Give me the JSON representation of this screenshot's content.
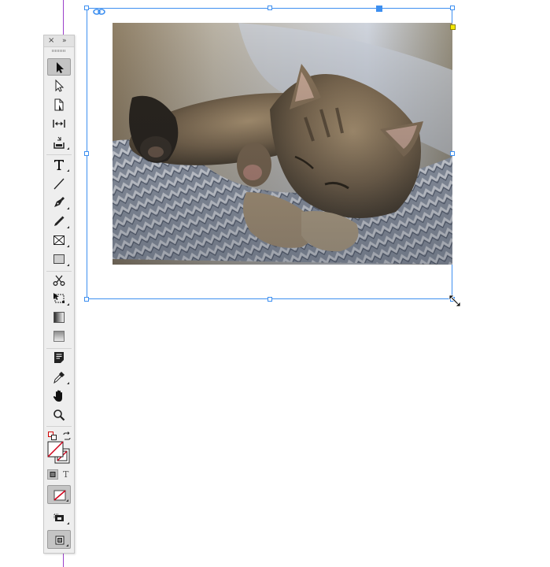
{
  "panel": {
    "close_glyph": "×",
    "collapse_glyph": "»",
    "tools": [
      {
        "name": "selection-tool",
        "icon": "black-arrow-icon",
        "selected": true
      },
      {
        "name": "direct-selection-tool",
        "icon": "white-arrow-icon"
      },
      {
        "name": "page-tool",
        "icon": "page-icon"
      },
      {
        "name": "gap-tool",
        "icon": "gap-arrows-icon"
      },
      {
        "name": "content-collector-tool",
        "icon": "content-collector-icon"
      },
      {
        "name": "type-tool",
        "icon": "type-T-icon"
      },
      {
        "name": "line-tool",
        "icon": "line-icon"
      },
      {
        "name": "pen-tool",
        "icon": "pen-icon"
      },
      {
        "name": "pencil-tool",
        "icon": "pencil-icon"
      },
      {
        "name": "rectangle-frame-tool",
        "icon": "rectangle-frame-icon"
      },
      {
        "name": "rectangle-tool",
        "icon": "rectangle-icon"
      },
      {
        "name": "scissors-tool",
        "icon": "scissors-icon"
      },
      {
        "name": "free-transform-tool",
        "icon": "free-transform-icon"
      },
      {
        "name": "gradient-swatch-tool",
        "icon": "gradient-swatch-icon"
      },
      {
        "name": "gradient-feather-tool",
        "icon": "gradient-feather-icon"
      },
      {
        "name": "note-tool",
        "icon": "note-icon"
      },
      {
        "name": "eyedropper-tool",
        "icon": "eyedropper-icon"
      },
      {
        "name": "hand-tool",
        "icon": "hand-icon"
      },
      {
        "name": "zoom-tool",
        "icon": "magnifier-icon"
      }
    ],
    "formatting_text_glyph": "T"
  },
  "colors": {
    "selection": "#3d8ff0",
    "page_guide": "#9b3fc9",
    "none_stroke": "#d0021b",
    "anchor_yellow": "#f2e600"
  }
}
